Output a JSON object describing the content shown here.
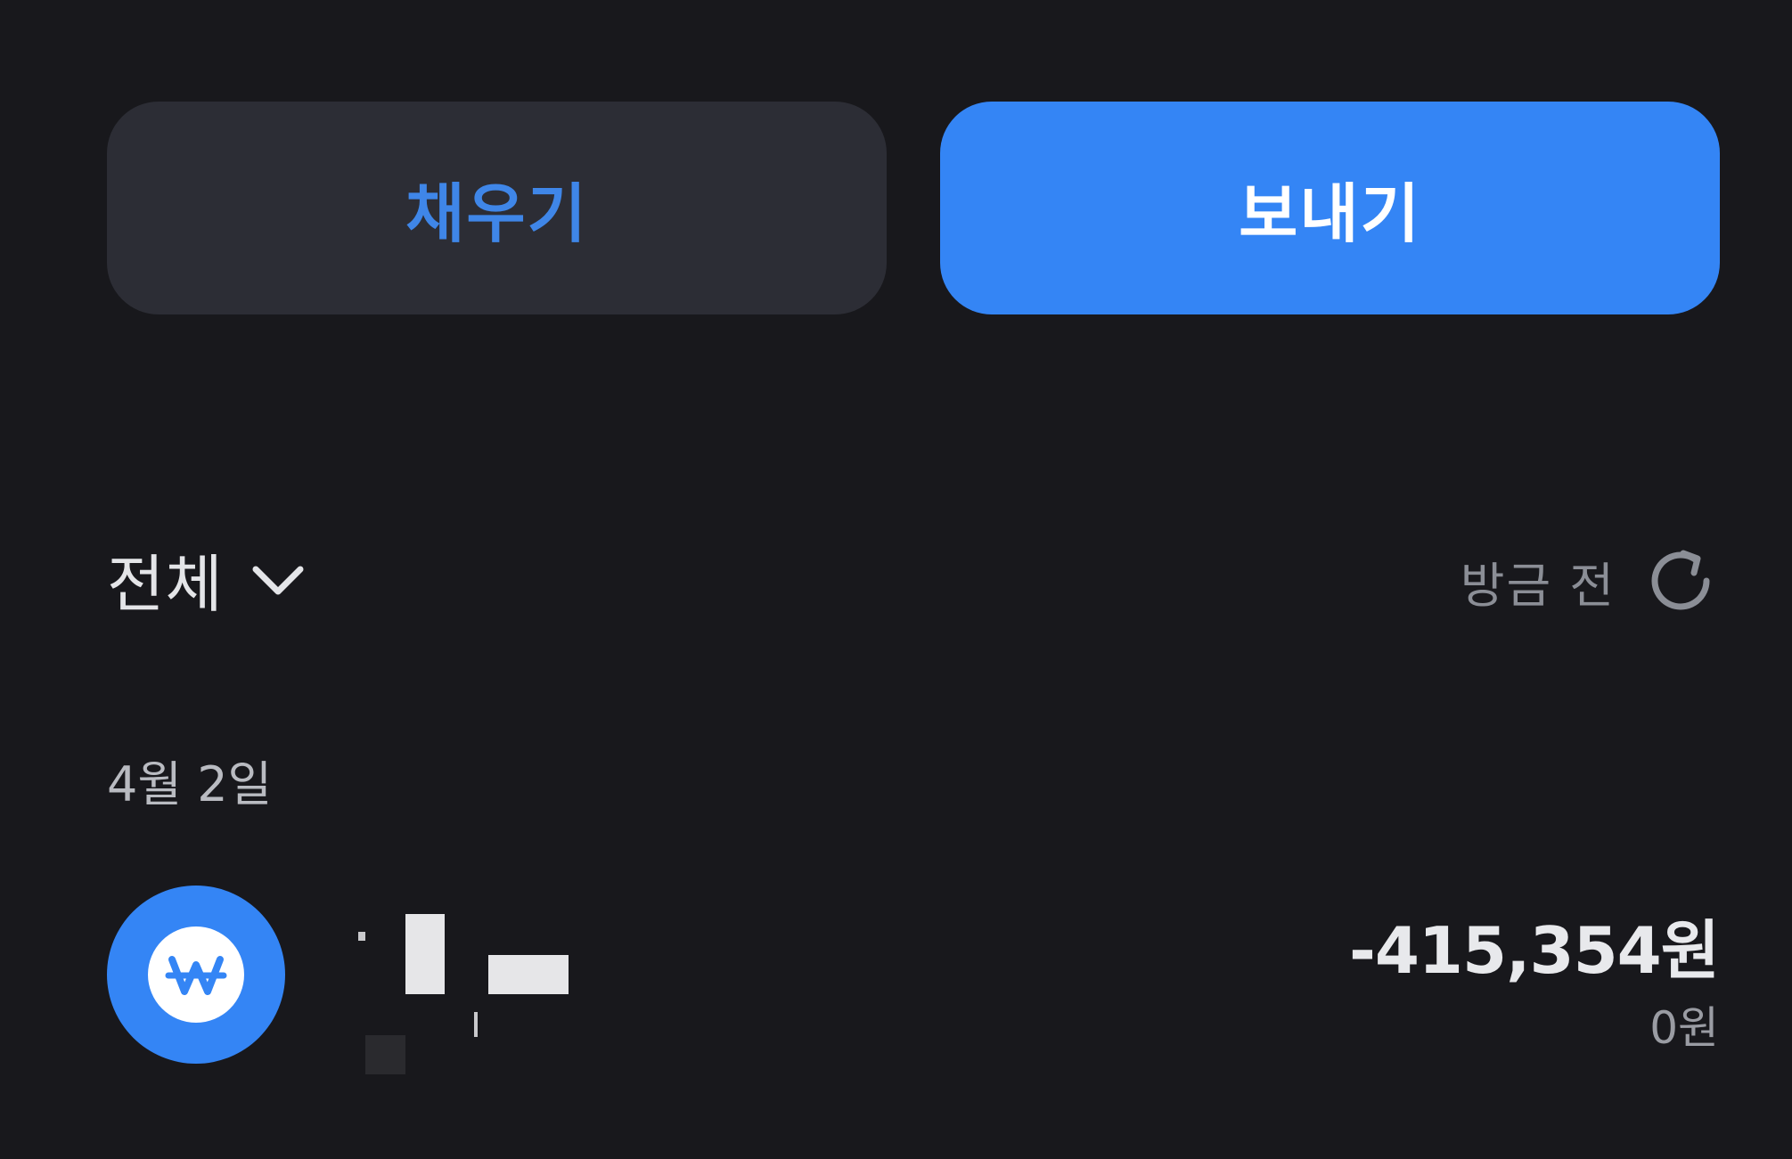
{
  "actions": {
    "fill_label": "채우기",
    "send_label": "보내기"
  },
  "colors": {
    "background": "#18181c",
    "accent": "#3485f5",
    "secondary_button": "#2c2d35"
  },
  "filter": {
    "selected": "전체",
    "icon": "chevron-down-icon"
  },
  "refresh": {
    "label": "방금 전",
    "icon": "refresh-icon"
  },
  "transactions": {
    "groups": [
      {
        "date": "4월 2일",
        "items": [
          {
            "icon": "won-icon",
            "amount": "-415,354원",
            "balance": "0원"
          }
        ]
      }
    ]
  }
}
